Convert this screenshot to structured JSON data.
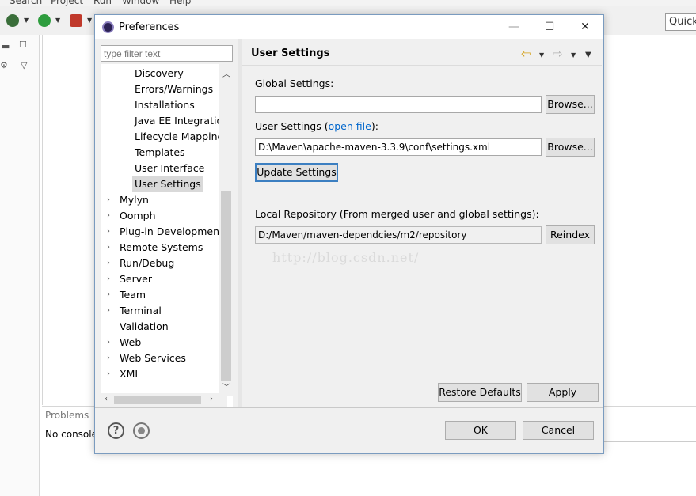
{
  "workbench": {
    "menu": [
      "Search",
      "Project",
      "Run",
      "Window",
      "Help"
    ],
    "quick_access_label": "Quick Access",
    "problems_tab_label": "Problems",
    "console_message": "No consoles"
  },
  "dialog": {
    "title": "Preferences",
    "filter_placeholder": "type filter text",
    "tree": [
      {
        "label": "Discovery",
        "level": 2
      },
      {
        "label": "Errors/Warnings",
        "level": 2
      },
      {
        "label": "Installations",
        "level": 2
      },
      {
        "label": "Java EE Integration",
        "level": 2
      },
      {
        "label": "Lifecycle Mappings",
        "level": 2
      },
      {
        "label": "Templates",
        "level": 2
      },
      {
        "label": "User Interface",
        "level": 2
      },
      {
        "label": "User Settings",
        "level": 2,
        "selected": true
      },
      {
        "label": "Mylyn",
        "level": 1,
        "expandable": true
      },
      {
        "label": "Oomph",
        "level": 1,
        "expandable": true
      },
      {
        "label": "Plug-in Development",
        "level": 1,
        "expandable": true
      },
      {
        "label": "Remote Systems",
        "level": 1,
        "expandable": true
      },
      {
        "label": "Run/Debug",
        "level": 1,
        "expandable": true
      },
      {
        "label": "Server",
        "level": 1,
        "expandable": true
      },
      {
        "label": "Team",
        "level": 1,
        "expandable": true
      },
      {
        "label": "Terminal",
        "level": 1,
        "expandable": true
      },
      {
        "label": "Validation",
        "level": 1,
        "expandable": false
      },
      {
        "label": "Web",
        "level": 1,
        "expandable": true
      },
      {
        "label": "Web Services",
        "level": 1,
        "expandable": true
      },
      {
        "label": "XML",
        "level": 1,
        "expandable": true
      }
    ],
    "page": {
      "title": "User Settings",
      "global_settings_label": "Global Settings:",
      "global_settings_value": "",
      "browse_label": "Browse...",
      "user_settings_label": "User Settings (",
      "user_settings_link": "open file",
      "user_settings_label_end": "):",
      "user_settings_value": "D:\\Maven\\apache-maven-3.3.9\\conf\\settings.xml",
      "update_settings_label": "Update Settings",
      "local_repo_label": "Local Repository (From merged user and global settings):",
      "local_repo_value": "D:/Maven/maven-dependcies/m2/repository",
      "reindex_label": "Reindex",
      "watermark": "http://blog.csdn.net/",
      "restore_defaults_label": "Restore Defaults",
      "apply_label": "Apply"
    },
    "footer": {
      "ok_label": "OK",
      "cancel_label": "Cancel"
    }
  },
  "colors": {
    "accent": "#3c7fc1",
    "link": "#0066cc",
    "selection": "#d9d9d9"
  }
}
